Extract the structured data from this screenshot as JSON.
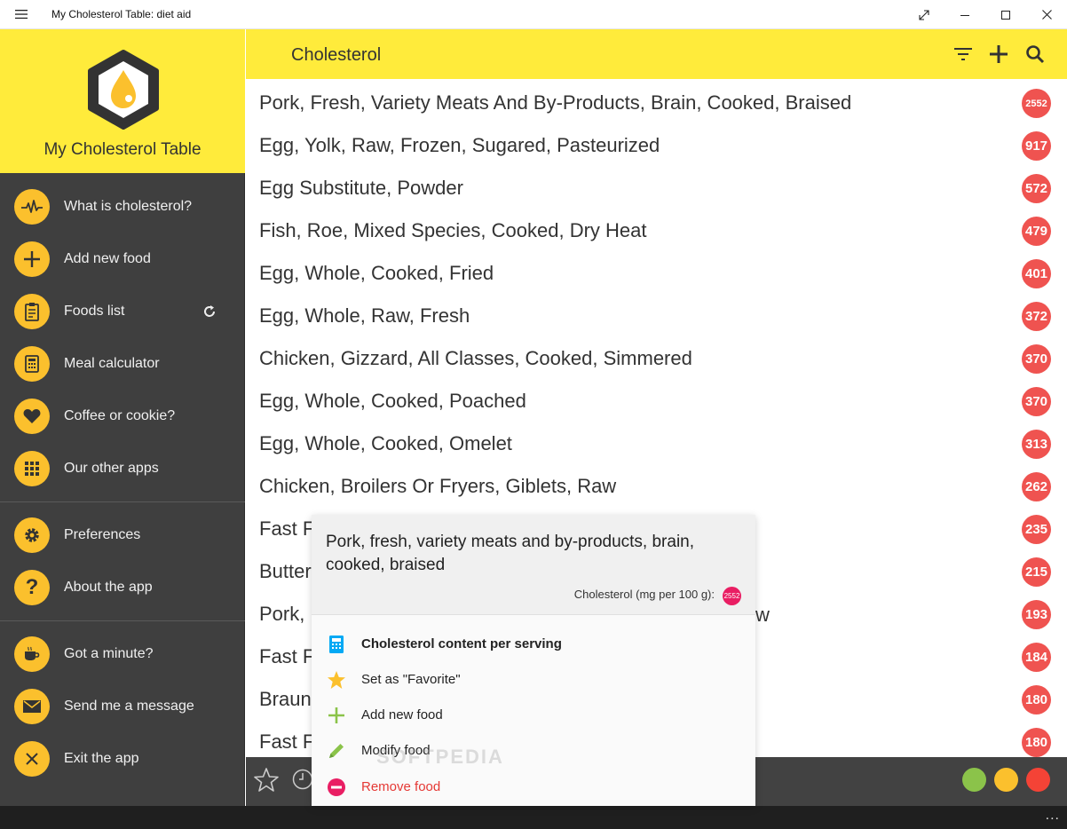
{
  "window": {
    "title": "My Cholesterol Table: diet aid"
  },
  "sidebar": {
    "app_name": "My Cholesterol Table",
    "items": [
      {
        "label": "What is cholesterol?",
        "icon": "heartbeat-icon"
      },
      {
        "label": "Add new food",
        "icon": "plus-icon"
      },
      {
        "label": "Foods list",
        "icon": "clipboard-icon"
      },
      {
        "label": "Meal calculator",
        "icon": "calculator-icon"
      },
      {
        "label": "Coffee or cookie?",
        "icon": "heart-icon"
      },
      {
        "label": "Our other apps",
        "icon": "grid-icon"
      },
      {
        "label": "Preferences",
        "icon": "gear-icon"
      },
      {
        "label": "About the app",
        "icon": "question-icon"
      },
      {
        "label": "Got a minute?",
        "icon": "coffee-icon"
      },
      {
        "label": "Send me a message",
        "icon": "envelope-icon"
      },
      {
        "label": "Exit the app",
        "icon": "close-icon"
      }
    ]
  },
  "header": {
    "title": "Cholesterol"
  },
  "foods": [
    {
      "name": "Pork, Fresh, Variety Meats And By-Products, Brain, Cooked, Braised",
      "value": "2552"
    },
    {
      "name": "Egg, Yolk, Raw, Frozen, Sugared, Pasteurized",
      "value": "917"
    },
    {
      "name": "Egg Substitute, Powder",
      "value": "572"
    },
    {
      "name": "Fish, Roe, Mixed Species, Cooked, Dry Heat",
      "value": "479"
    },
    {
      "name": "Egg, Whole, Cooked, Fried",
      "value": "401"
    },
    {
      "name": "Egg, Whole, Raw, Fresh",
      "value": "372"
    },
    {
      "name": "Chicken, Gizzard, All Classes, Cooked, Simmered",
      "value": "370"
    },
    {
      "name": "Egg, Whole, Cooked, Poached",
      "value": "370"
    },
    {
      "name": "Egg, Whole, Cooked, Omelet",
      "value": "313"
    },
    {
      "name": "Chicken, Broilers Or Fryers, Giblets, Raw",
      "value": "262"
    },
    {
      "name": "Fast Fo",
      "value": "235"
    },
    {
      "name": "Butter",
      "value": "215"
    },
    {
      "name": "Pork, F",
      "value": "193"
    },
    {
      "name": "Fast Fo",
      "value": "184"
    },
    {
      "name": "Brauns",
      "value": "180"
    },
    {
      "name": "Fast Fo",
      "value": "180"
    }
  ],
  "popup": {
    "title": "Pork, fresh, variety meats and by-products, brain, cooked, braised",
    "cholesterol_label": "Cholesterol (mg per 100 g):",
    "cholesterol_value": "2552",
    "items": [
      {
        "label": "Cholesterol content per serving",
        "icon": "calculator-icon"
      },
      {
        "label": "Set as \"Favorite\"",
        "icon": "star-icon"
      },
      {
        "label": "Add new food",
        "icon": "plus-icon"
      },
      {
        "label": "Modify food",
        "icon": "pencil-icon"
      },
      {
        "label": "Remove food",
        "icon": "minus-circle-icon"
      }
    ],
    "peek_fragment": "w"
  },
  "watermark": "SOFTPEDIA",
  "colors": {
    "accent_yellow": "#ffeb3b",
    "nav_circle": "#fbc02d",
    "badge_red": "#ef5350",
    "popup_badge": "#e91e63",
    "dot_green": "#8bc34a",
    "dot_yellow": "#fbc02d",
    "dot_red": "#f44336",
    "sidebar_bg": "#3f3f3f"
  },
  "taskbar": {
    "more": "..."
  }
}
